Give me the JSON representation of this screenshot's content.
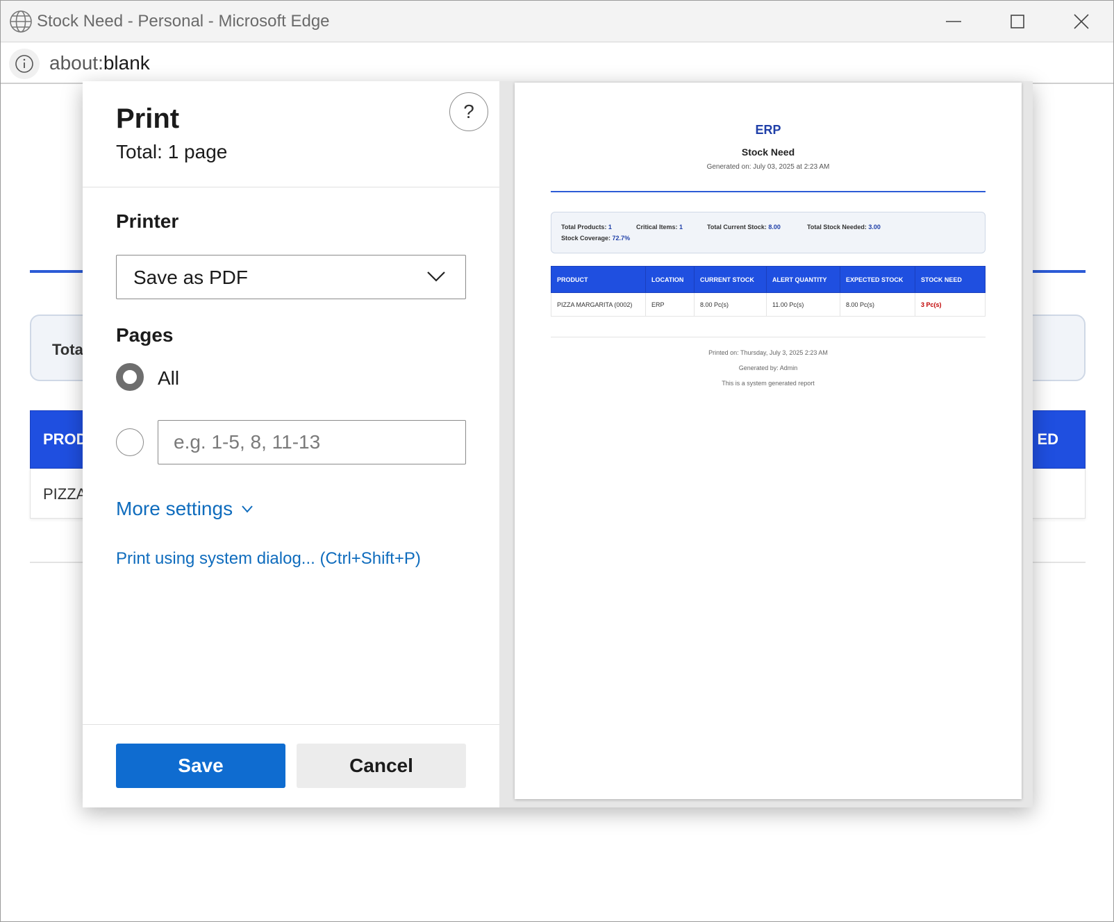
{
  "window": {
    "title": "Stock Need - Personal - Microsoft Edge",
    "url_scheme": "about:",
    "url_rest": "blank"
  },
  "background_page": {
    "summary_fragment": "Tota",
    "header_left_fragment": "PROD",
    "header_right_fragment": "ED",
    "row_fragment": "PIZZA"
  },
  "print_dialog": {
    "title": "Print",
    "total": "Total: 1 page",
    "printer_label": "Printer",
    "printer_value": "Save as PDF",
    "pages_label": "Pages",
    "pages_all": "All",
    "pages_range_placeholder": "e.g. 1-5, 8, 11-13",
    "more_settings": "More settings",
    "system_dialog_link": "Print using system dialog... (Ctrl+Shift+P)",
    "save_button": "Save",
    "cancel_button": "Cancel",
    "help": "?"
  },
  "preview": {
    "company": "ERP",
    "report_title": "Stock Need",
    "generated_on": "Generated on: July 03, 2025 at 2:23 AM",
    "summary": {
      "total_products_label": "Total Products:",
      "total_products_value": "1",
      "critical_items_label": "Critical Items:",
      "critical_items_value": "1",
      "total_current_stock_label": "Total Current Stock:",
      "total_current_stock_value": "8.00",
      "total_stock_needed_label": "Total Stock Needed:",
      "total_stock_needed_value": "3.00",
      "stock_coverage_label": "Stock Coverage:",
      "stock_coverage_value": "72.7%"
    },
    "table": {
      "headers": [
        "PRODUCT",
        "LOCATION",
        "CURRENT STOCK",
        "ALERT QUANTITY",
        "EXPECTED STOCK",
        "STOCK NEED"
      ],
      "rows": [
        [
          "PIZZA MARGARITA (0002)",
          "ERP",
          "8.00 Pc(s)",
          "11.00 Pc(s)",
          "8.00 Pc(s)",
          "3 Pc(s)"
        ]
      ]
    },
    "footer": {
      "printed_on": "Printed on: Thursday, July 3, 2025 2:23 AM",
      "generated_by": "Generated by: Admin",
      "note": "This is a system generated report"
    }
  },
  "colors": {
    "accent_blue": "#0f6cd0",
    "link_blue": "#0f6cbd",
    "table_header": "#1f4fe0",
    "stock_need_red": "#c00000"
  }
}
